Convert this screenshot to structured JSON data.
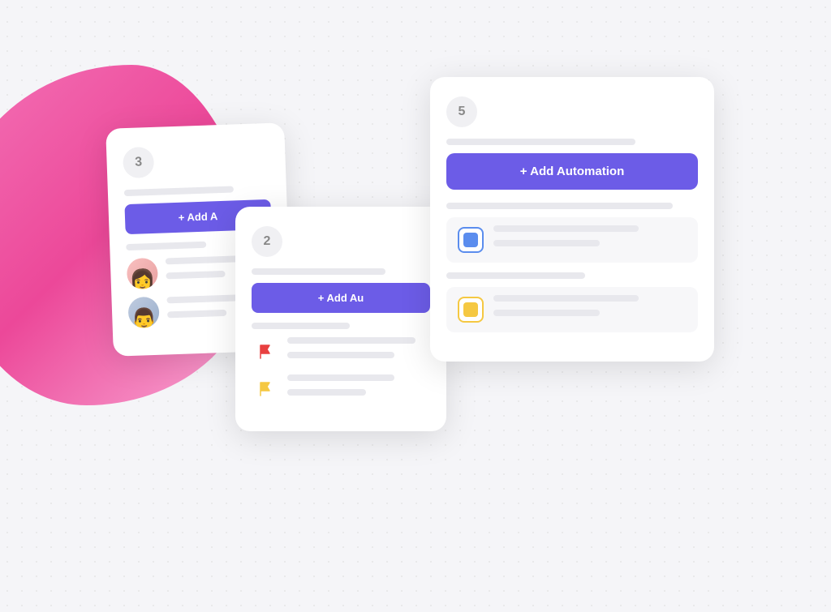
{
  "background": {
    "dot_color": "#cccccc"
  },
  "card1": {
    "number": "3",
    "add_button_label": "+ Add A",
    "placeholder_lines": [
      "short",
      "medium"
    ],
    "avatars": [
      "female",
      "male"
    ]
  },
  "card2": {
    "number": "2",
    "add_button_label": "+ Add Au",
    "placeholder_lines": [
      "medium",
      "short"
    ],
    "flags": [
      "red",
      "yellow"
    ]
  },
  "card3": {
    "number": "5",
    "add_button_label": "+ Add Automation",
    "placeholder_lines_top": [
      "medium"
    ],
    "placeholder_lines_bottom": [
      "short",
      "short"
    ],
    "items": [
      {
        "type": "blue",
        "lines": [
          "medium",
          "short"
        ]
      },
      {
        "type": "yellow",
        "lines": [
          "medium",
          "short"
        ]
      }
    ]
  }
}
